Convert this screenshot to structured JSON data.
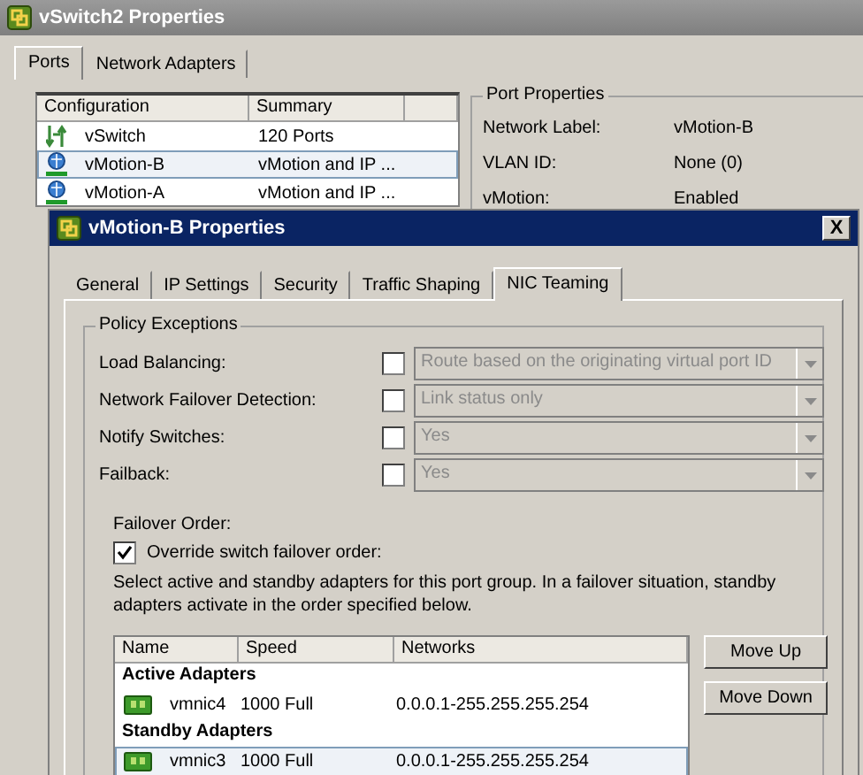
{
  "window": {
    "title": "vSwitch2 Properties"
  },
  "tabs": [
    {
      "label": "Ports",
      "selected": true
    },
    {
      "label": "Network Adapters",
      "selected": false
    }
  ],
  "ports_list": {
    "columns": [
      "Configuration",
      "Summary"
    ],
    "rows": [
      {
        "kind": "switch",
        "name": "vSwitch",
        "summary": "120 Ports",
        "selected": false
      },
      {
        "kind": "vmkernel",
        "name": "vMotion-B",
        "summary": "vMotion and IP ...",
        "selected": true
      },
      {
        "kind": "vmkernel",
        "name": "vMotion-A",
        "summary": "vMotion and IP ...",
        "selected": false
      }
    ]
  },
  "port_properties": {
    "title": "Port Properties",
    "fields": [
      {
        "label": "Network Label:",
        "value": "vMotion-B"
      },
      {
        "label": "VLAN ID:",
        "value": "None (0)"
      },
      {
        "label": "vMotion:",
        "value": "Enabled"
      }
    ]
  },
  "dialog": {
    "title": "vMotion-B Properties",
    "close": "X",
    "tabs": [
      {
        "label": "General",
        "selected": false
      },
      {
        "label": "IP Settings",
        "selected": false
      },
      {
        "label": "Security",
        "selected": false
      },
      {
        "label": "Traffic Shaping",
        "selected": false
      },
      {
        "label": "NIC Teaming",
        "selected": true
      }
    ],
    "policy_exceptions": {
      "title": "Policy Exceptions",
      "rows": [
        {
          "label": "Load Balancing:",
          "checked": false,
          "value": "Route based on the originating virtual port ID",
          "disabled": true
        },
        {
          "label": "Network Failover Detection:",
          "checked": false,
          "value": "Link status only",
          "disabled": true
        },
        {
          "label": "Notify Switches:",
          "checked": false,
          "value": "Yes",
          "disabled": true
        },
        {
          "label": "Failback:",
          "checked": false,
          "value": "Yes",
          "disabled": true
        }
      ],
      "failover_order": {
        "label": "Failover Order:",
        "override": {
          "label": "Override switch failover order:",
          "checked": true
        },
        "description": "Select active and standby adapters for this port group.  In a failover situation, standby adapters activate  in the order specified below.",
        "table": {
          "columns": [
            "Name",
            "Speed",
            "Networks"
          ],
          "groups": [
            {
              "title": "Active Adapters",
              "rows": [
                {
                  "name": "vmnic4",
                  "speed": "1000 Full",
                  "networks": "0.0.0.1-255.255.255.254",
                  "selected": false
                }
              ]
            },
            {
              "title": "Standby Adapters",
              "rows": [
                {
                  "name": "vmnic3",
                  "speed": "1000 Full",
                  "networks": "0.0.0.1-255.255.255.254",
                  "selected": true
                }
              ]
            }
          ]
        },
        "buttons": [
          "Move Up",
          "Move Down"
        ]
      }
    }
  }
}
